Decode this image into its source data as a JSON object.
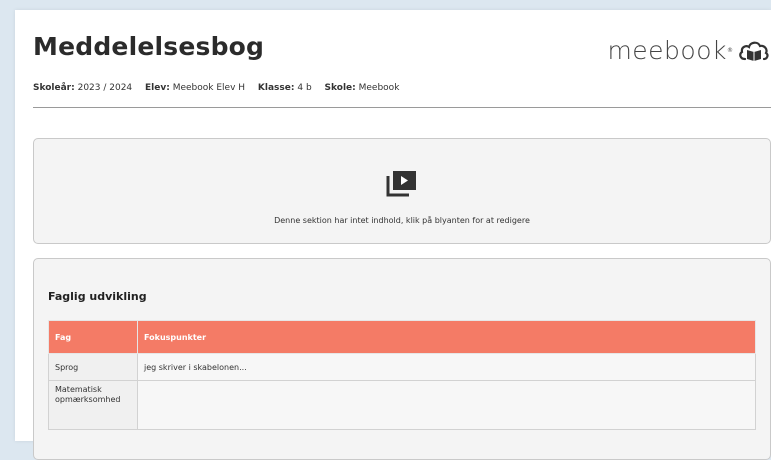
{
  "header": {
    "title": "Meddelelsesbog",
    "meta": [
      {
        "label": "Skoleår:",
        "value": "2023 / 2024"
      },
      {
        "label": "Elev:",
        "value": "Meebook Elev H"
      },
      {
        "label": "Klasse:",
        "value": "4 b"
      },
      {
        "label": "Skole:",
        "value": "Meebook"
      }
    ],
    "logo": {
      "text": "meebook",
      "reg": "®",
      "icon": "cloud-book-icon"
    }
  },
  "empty_section": {
    "icon": "video-playlist-icon",
    "text": "Denne sektion har intet indhold, klik på blyanten for at redigere"
  },
  "faglig_section": {
    "title": "Faglig udvikling",
    "columns": [
      "Fag",
      "Fokuspunkter"
    ],
    "rows": [
      {
        "fag": "Sprog",
        "fokus": "jeg skriver i skabelonen..."
      },
      {
        "fag": "Matematisk opmærksomhed",
        "fokus": ""
      }
    ]
  },
  "colors": {
    "accent_header": "#f47b66",
    "page_background": "#dce7f0"
  }
}
